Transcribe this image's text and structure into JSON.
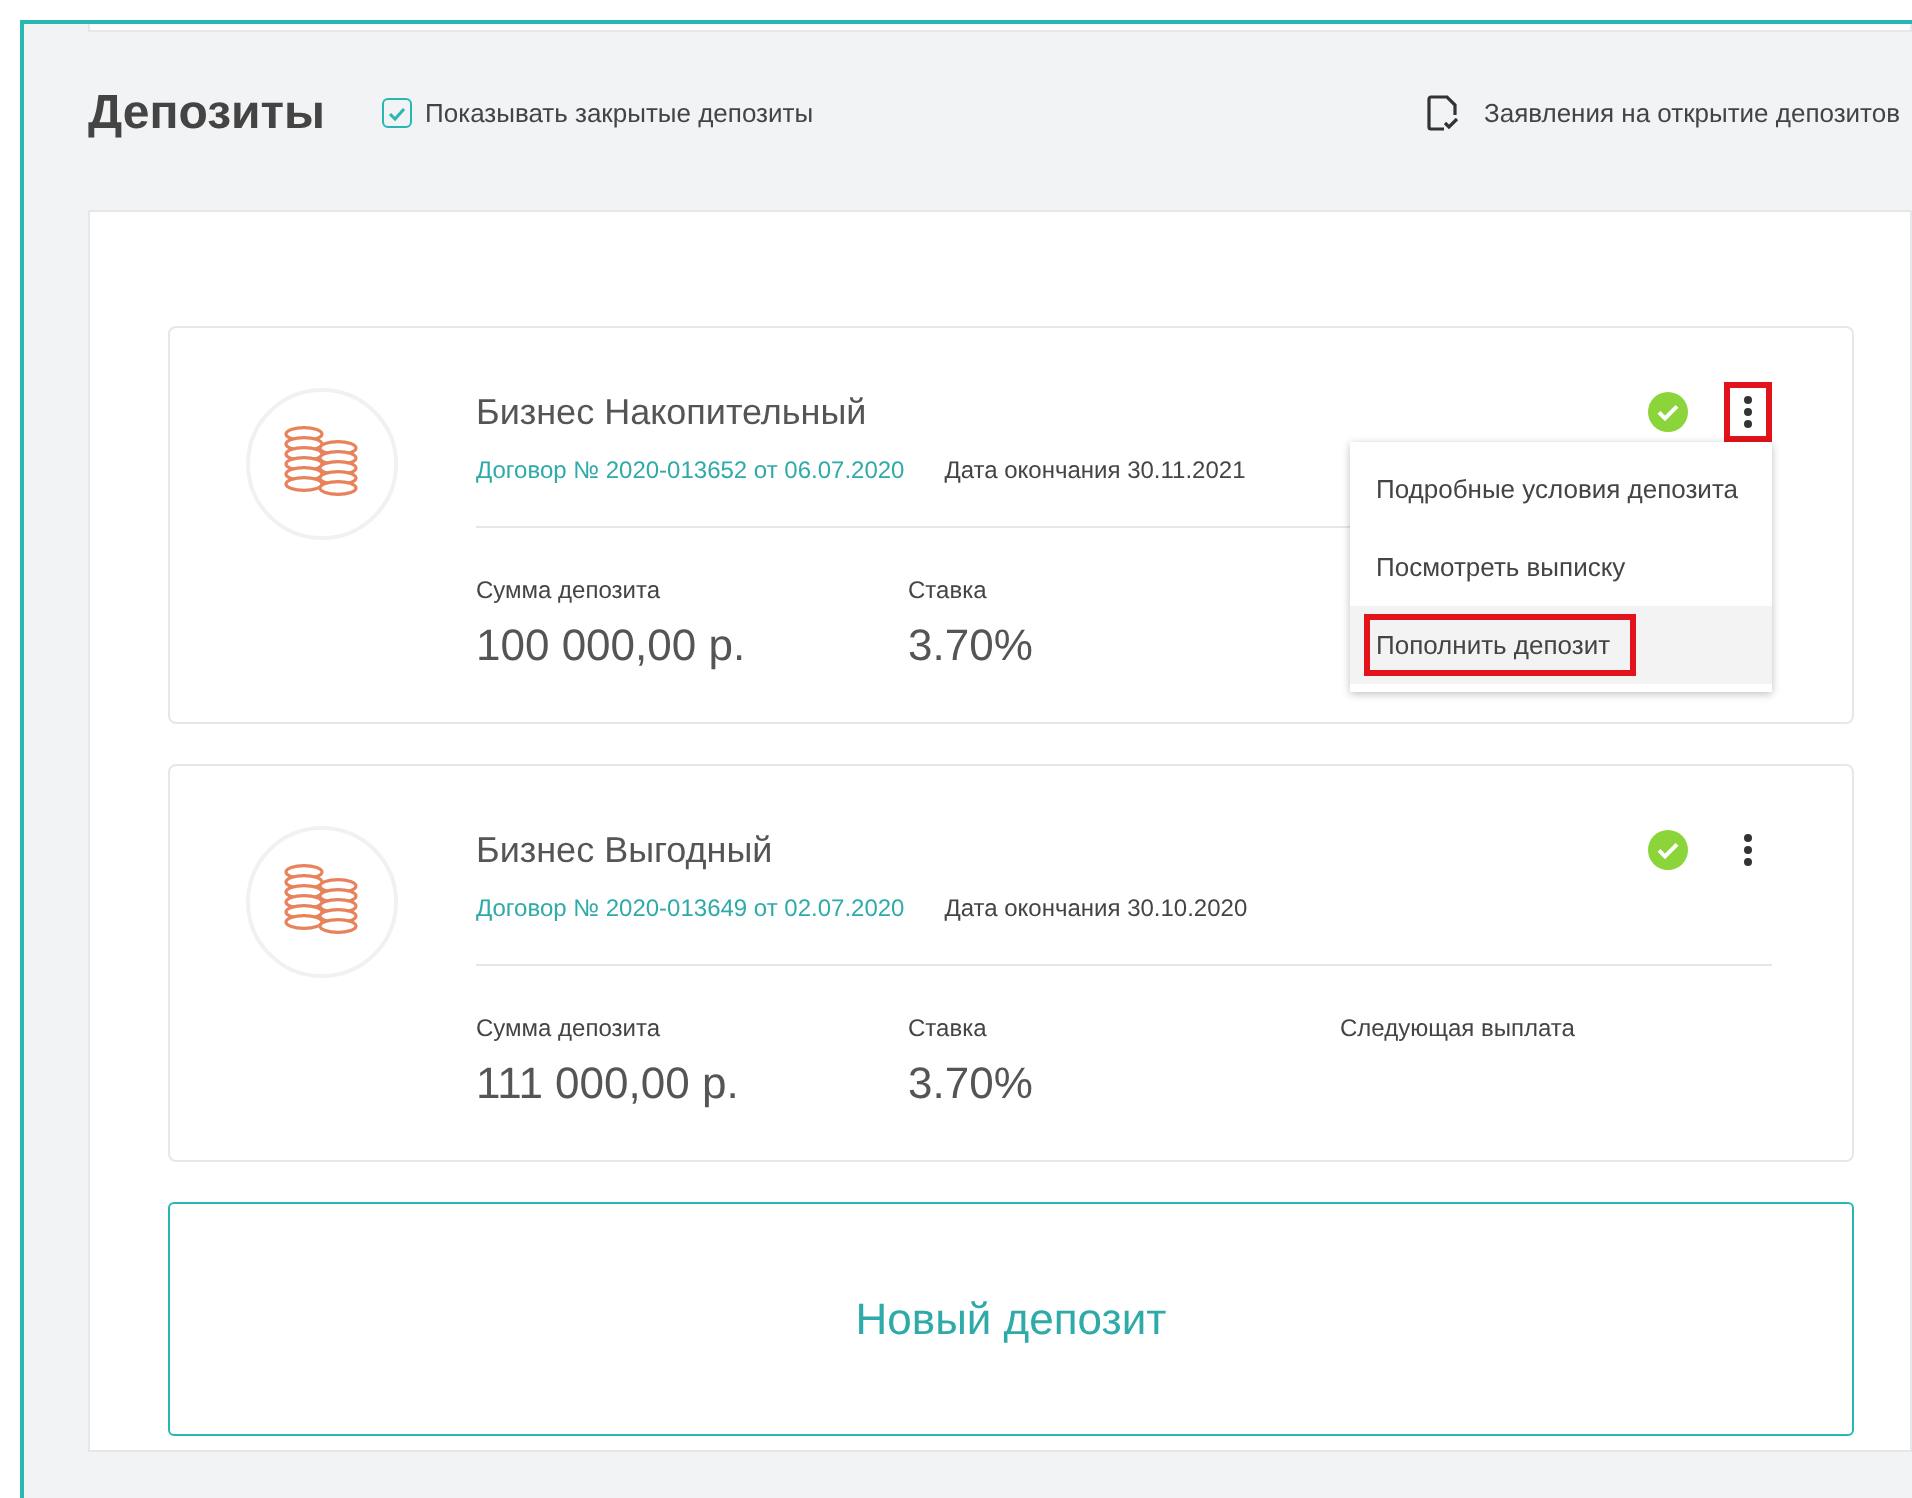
{
  "header": {
    "title": "Депозиты",
    "show_closed": {
      "label": "Показывать закрытые депозиты",
      "checked": true
    },
    "applications_link": "Заявления на открытие депозитов"
  },
  "deposits": [
    {
      "name": "Бизнес Накопительный",
      "contract": "Договор № 2020-013652 от 06.07.2020",
      "end_date": "Дата окончания 30.11.2021",
      "active": true,
      "menu_highlighted": true,
      "fields": [
        {
          "label": "Сумма депозита",
          "value": "100 000,00 р."
        },
        {
          "label": "Ставка",
          "value": "3.70%"
        }
      ],
      "menu": {
        "items": [
          {
            "label": "Подробные условия депозита",
            "hovered": false,
            "highlighted": false
          },
          {
            "label": "Посмотреть выписку",
            "hovered": false,
            "highlighted": false
          },
          {
            "label": "Пополнить депозит",
            "hovered": true,
            "highlighted": true
          }
        ]
      }
    },
    {
      "name": "Бизнес Выгодный",
      "contract": "Договор № 2020-013649 от 02.07.2020",
      "end_date": "Дата окончания 30.10.2020",
      "active": true,
      "menu_highlighted": false,
      "fields": [
        {
          "label": "Сумма депозита",
          "value": "111 000,00 р."
        },
        {
          "label": "Ставка",
          "value": "3.70%"
        },
        {
          "label": "Следующая выплата"
        }
      ]
    }
  ],
  "new_deposit": "Новый депозит"
}
